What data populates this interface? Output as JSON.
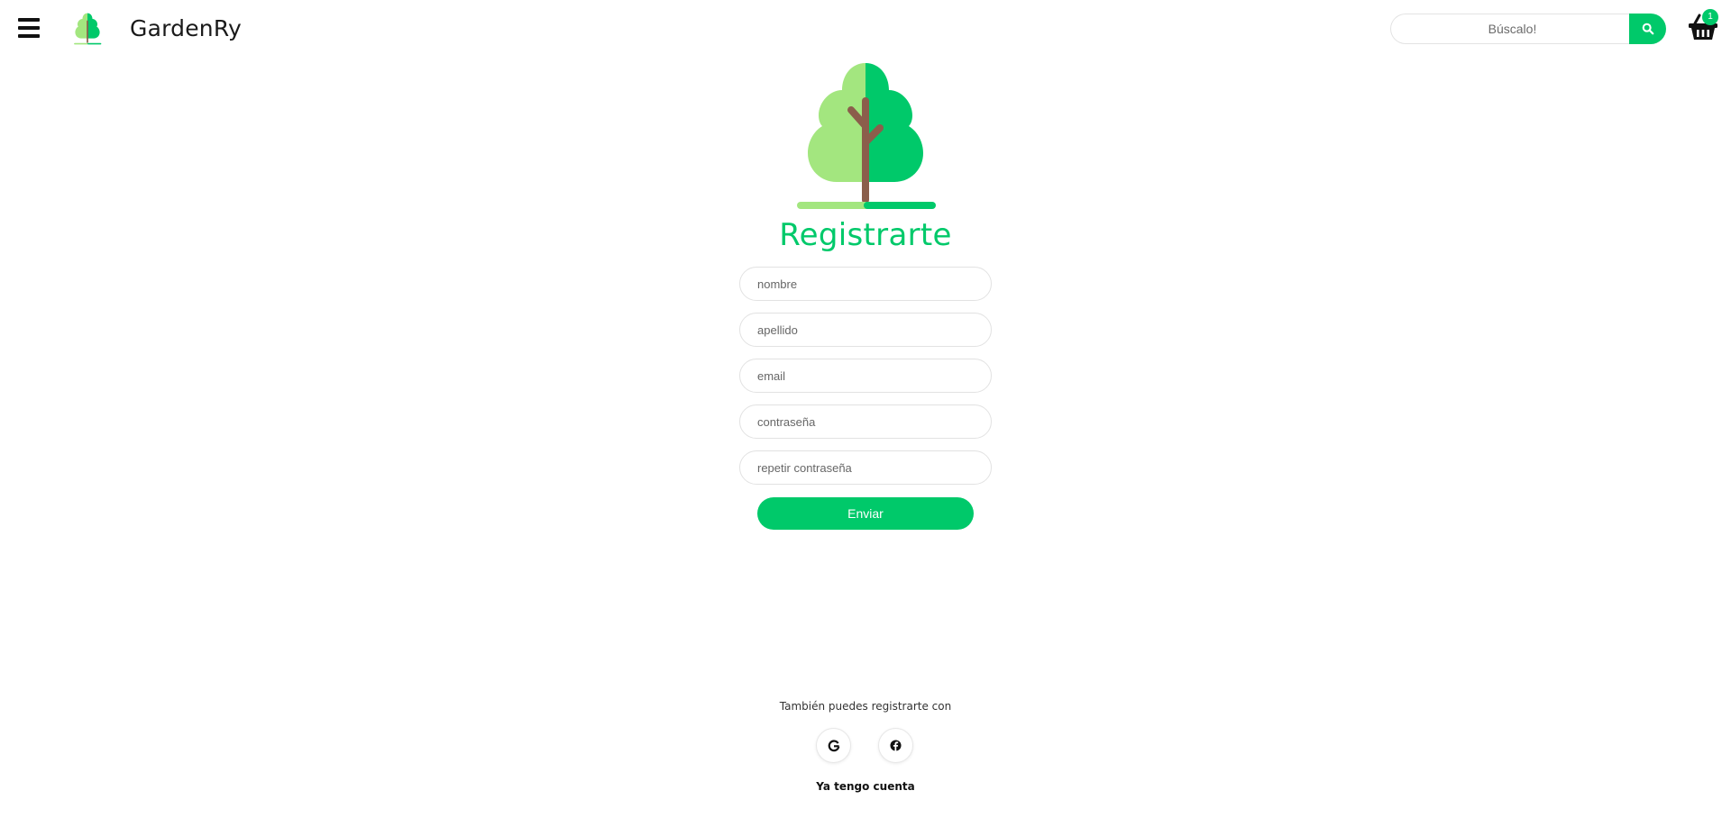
{
  "header": {
    "brand": "GardenRy",
    "search": {
      "placeholder": "Búscalo!",
      "value": ""
    },
    "cart": {
      "count": "1"
    }
  },
  "icons": {
    "menu": "hamburger-menu-icon",
    "logo": "tree-logo-icon",
    "search": "magnifier-icon",
    "cart": "shopping-basket-icon",
    "google": "google-icon",
    "facebook": "facebook-icon"
  },
  "register": {
    "title": "Registrarte",
    "fields": {
      "nombre": "nombre",
      "apellido": "apellido",
      "email": "email",
      "password": "contraseña",
      "repeat_password": "repetir contraseña"
    },
    "submit": "Enviar"
  },
  "social": {
    "label": "También puedes registrarte con"
  },
  "login_link": "Ya tengo cuenta",
  "colors": {
    "accent": "#00c96a",
    "tree_light": "#a3e67f",
    "tree_dark": "#00c96a",
    "trunk": "#8b5e4b"
  }
}
